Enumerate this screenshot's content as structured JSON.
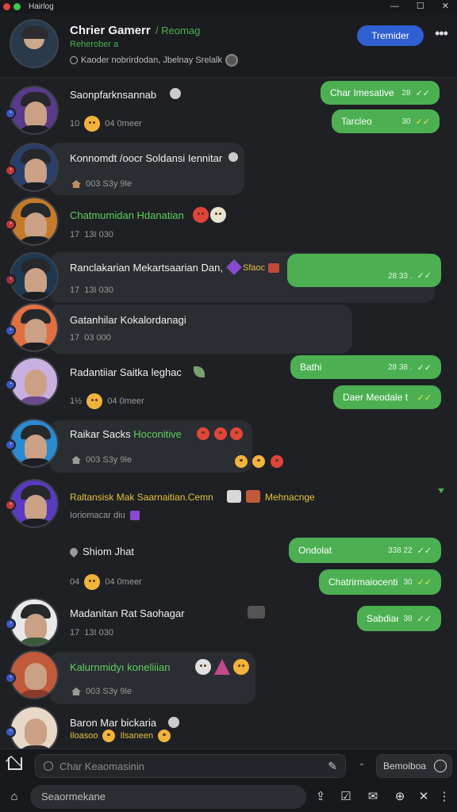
{
  "window": {
    "title": "Hairlog",
    "controls": [
      "—",
      "☐",
      "✕"
    ]
  },
  "header": {
    "name": "Chrier Gamerr",
    "status": "/ Reomag",
    "subtitle": "Reherober a",
    "description": "Kaoder nobrirdodan, Jbelnay Srelalk",
    "button": "Tremider",
    "more": "•••"
  },
  "messages": [
    {
      "title": "Saonpfarknsannab",
      "meta": "10",
      "meta2": "04 0meer"
    },
    {
      "title": "Konnomdt /oocr Soldansi Iennitar",
      "meta": "003 S3y 9le"
    },
    {
      "title": "Chatmumidan Hdanatian",
      "meta": "17",
      "meta2": "13I 030"
    },
    {
      "title": "Ranclakarian Mekartsaarian Dan,",
      "title_extra": "Sfaoc",
      "meta": "17",
      "meta2": "13I 030"
    },
    {
      "title": "Gatanhilar Kokalordanagi",
      "meta": "17",
      "meta2": "03 000"
    },
    {
      "title": "Radantiiar Saitka leghac",
      "meta": "1½",
      "meta2": "04 0meer"
    },
    {
      "title": "Raikar Sacks",
      "title_green": "Hoconitive",
      "meta": "003 S3y 9le"
    },
    {
      "title": "Raltansisk Mak Saarnaitian.Cemn",
      "title_extra": "Mehnacnge",
      "meta": "Ioriomacar diu"
    },
    {
      "title": "Shiom Jhat",
      "meta": "04",
      "meta2": "04 0meer"
    },
    {
      "title": "Madanitan Rat Saohagar",
      "meta": "17",
      "meta2": "13I 030"
    },
    {
      "title": "Kalurnmidyı koneliiian",
      "meta": "003 S3y 9le"
    },
    {
      "title": "Baron Mar bickaria",
      "meta": "Iloasoo",
      "meta2": "Ilsaneen"
    }
  ],
  "outgoing": [
    {
      "text": "Char Imesative",
      "time": "28",
      "tick": "✓✓"
    },
    {
      "text": "Tarcleo",
      "time": "30",
      "tick": "✓✓"
    },
    {
      "text": "",
      "time": "28 33 .",
      "tick": "✓✓"
    },
    {
      "text": "Bathi",
      "time": "28 38 .",
      "tick": "✓✓"
    },
    {
      "text": "Daer Meodale to.",
      "time": "",
      "tick": "✓✓"
    },
    {
      "text": "Ondolat",
      "time": "338 22",
      "tick": "✓✓"
    },
    {
      "text": "Chatrirmaiocentio",
      "time": "30",
      "tick": "✓✓"
    },
    {
      "text": "Sabdiae",
      "time": "38",
      "tick": "✓✓"
    }
  ],
  "composer": {
    "placeholder": "Char Keaomasinin",
    "send_label": "Bemoiboa",
    "search_placeholder": "Seaormekane"
  },
  "colors": {
    "accent": "#2f5fd0",
    "outgoing": "#4cb052",
    "background": "#1e2024"
  }
}
